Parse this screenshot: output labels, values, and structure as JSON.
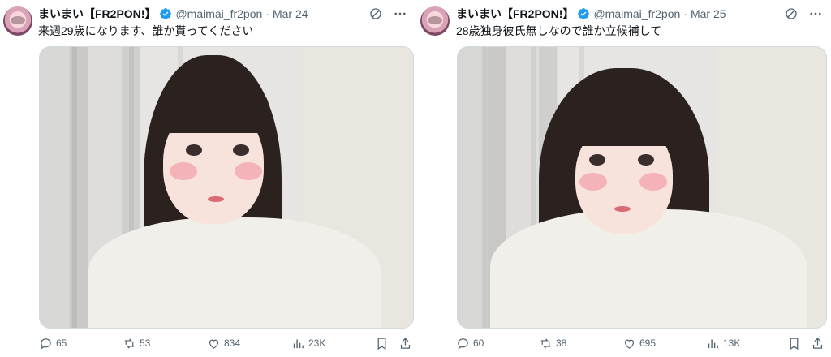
{
  "tweets": [
    {
      "display_name": "まいまい【FR2PON!】",
      "handle": "@maimai_fr2pon",
      "separator": "·",
      "date": "Mar 24",
      "text": "来週29歳になります、誰か貰ってください",
      "actions": {
        "replies": "65",
        "reposts": "53",
        "likes": "834",
        "views": "23K"
      }
    },
    {
      "display_name": "まいまい【FR2PON!】",
      "handle": "@maimai_fr2pon",
      "separator": "·",
      "date": "Mar 25",
      "text": "28歳独身彼氏無しなので誰か立候補して",
      "actions": {
        "replies": "60",
        "reposts": "38",
        "likes": "695",
        "views": "13K"
      }
    }
  ],
  "colors": {
    "verified": "#1d9bf0",
    "secondary_text": "#536471",
    "primary_text": "#0f1419"
  },
  "icons": [
    "verified-badge-icon",
    "grok-icon",
    "more-icon",
    "reply-icon",
    "repost-icon",
    "like-icon",
    "views-icon",
    "bookmark-icon",
    "share-icon"
  ]
}
